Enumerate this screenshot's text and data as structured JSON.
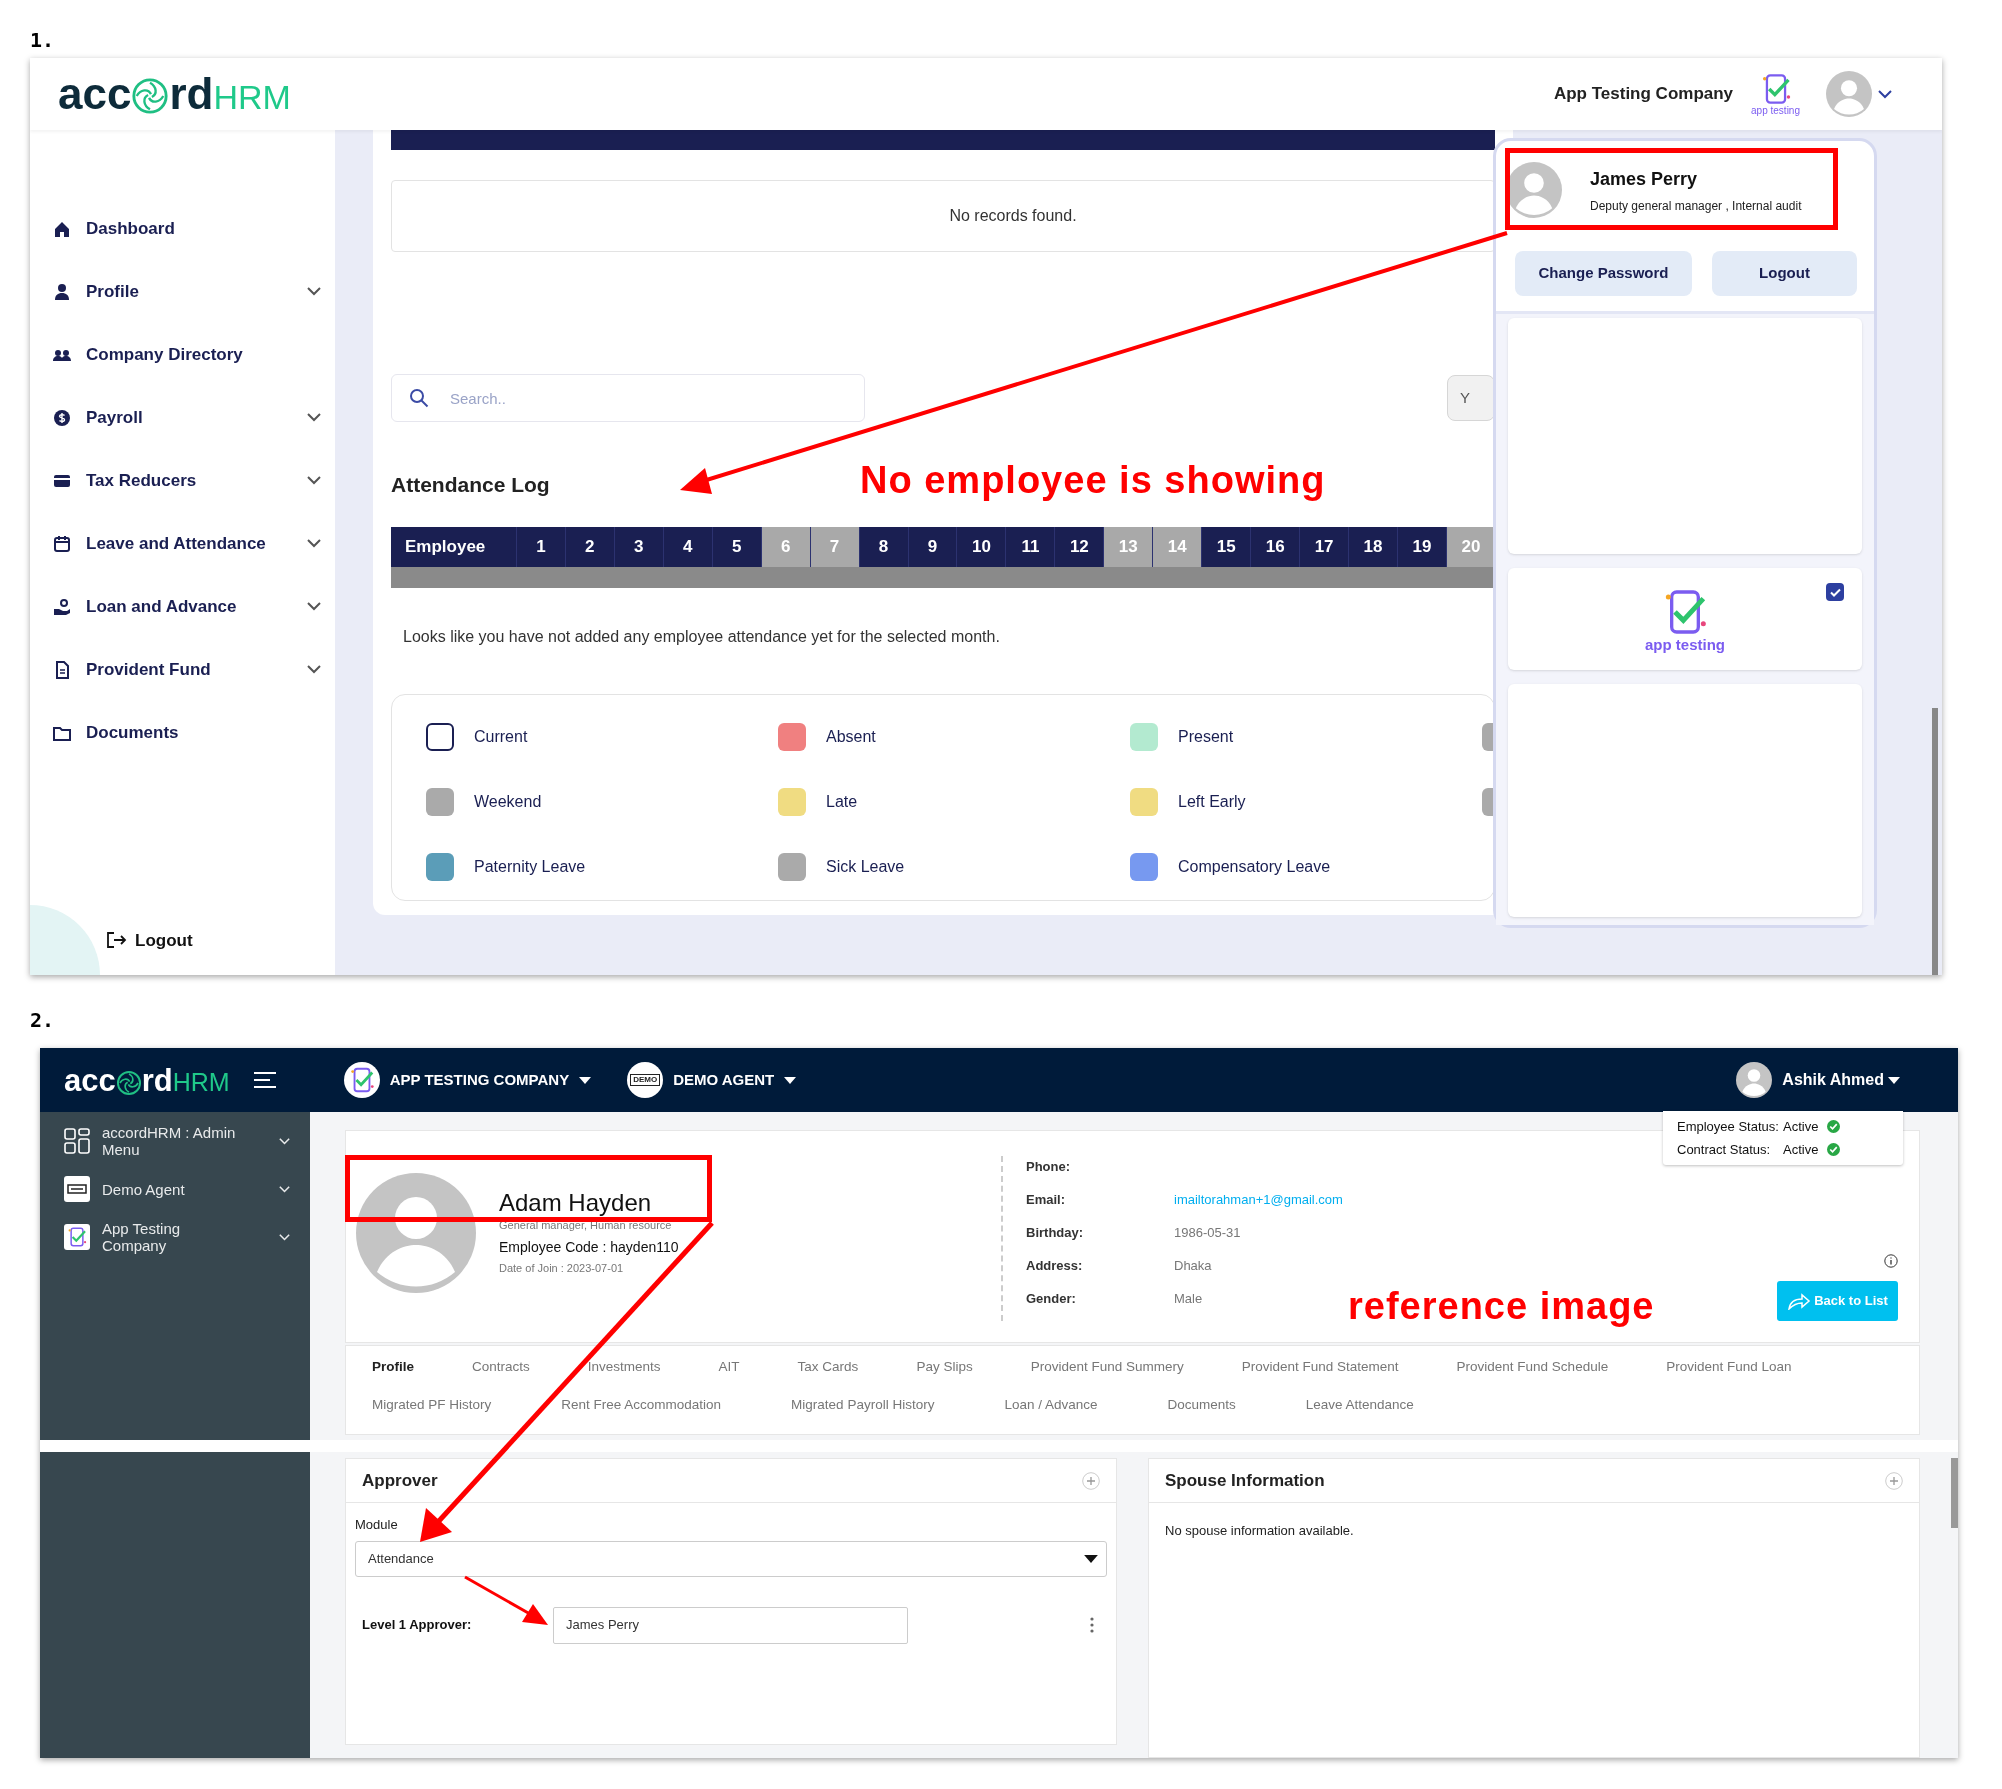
{
  "panel_1": {
    "label": "1.",
    "header": {
      "logo": {
        "left": "acc",
        "right": "rd",
        "suffix": "HRM"
      },
      "company": "App Testing Company",
      "company_logo_text": "app testing"
    },
    "sidebar": {
      "items": [
        {
          "label": "Dashboard",
          "has_submenu": false
        },
        {
          "label": "Profile",
          "has_submenu": true
        },
        {
          "label": "Company Directory",
          "has_submenu": false
        },
        {
          "label": "Payroll",
          "has_submenu": true
        },
        {
          "label": "Tax Reducers",
          "has_submenu": true
        },
        {
          "label": "Leave and Attendance",
          "has_submenu": true
        },
        {
          "label": "Loan and Advance",
          "has_submenu": true
        },
        {
          "label": "Provident Fund",
          "has_submenu": true
        },
        {
          "label": "Documents",
          "has_submenu": false
        }
      ],
      "logout": "Logout"
    },
    "records_message": "No records found.",
    "search": {
      "placeholder": "Search.."
    },
    "cut_button": "Y",
    "title": "Attendance Log",
    "day_header": {
      "first": "Employee",
      "days": [
        {
          "label": "1",
          "weekend": false
        },
        {
          "label": "2",
          "weekend": false
        },
        {
          "label": "3",
          "weekend": false
        },
        {
          "label": "4",
          "weekend": false
        },
        {
          "label": "5",
          "weekend": false
        },
        {
          "label": "6",
          "weekend": true
        },
        {
          "label": "7",
          "weekend": true
        },
        {
          "label": "8",
          "weekend": false
        },
        {
          "label": "9",
          "weekend": false
        },
        {
          "label": "10",
          "weekend": false
        },
        {
          "label": "11",
          "weekend": false
        },
        {
          "label": "12",
          "weekend": false
        },
        {
          "label": "13",
          "weekend": true
        },
        {
          "label": "14",
          "weekend": true
        },
        {
          "label": "15",
          "weekend": false
        },
        {
          "label": "16",
          "weekend": false
        },
        {
          "label": "17",
          "weekend": false
        },
        {
          "label": "18",
          "weekend": false
        },
        {
          "label": "19",
          "weekend": false
        },
        {
          "label": "20",
          "weekend": true
        }
      ]
    },
    "empty_message": "Looks like you have not added any employee attendance yet for the selected month.",
    "legend": [
      {
        "label": "Current",
        "kind": "outline",
        "color": "#1a1f52"
      },
      {
        "label": "Absent",
        "kind": "swatch",
        "color": "#f08080"
      },
      {
        "label": "Present",
        "kind": "swatch",
        "color": "#b3ead0"
      },
      {
        "kind": "swatch",
        "color": "#aaaaaa"
      },
      {
        "label": "Weekend",
        "kind": "swatch",
        "color": "#aaaaaa"
      },
      {
        "label": "Late",
        "kind": "swatch",
        "color": "#f0dc82"
      },
      {
        "label": "Left Early",
        "kind": "swatch",
        "color": "#f0dc82"
      },
      {
        "kind": "swatch",
        "color": "#aaaaaa"
      },
      {
        "label": "Paternity Leave",
        "kind": "swatch",
        "color": "#5b9db8"
      },
      {
        "label": "Sick Leave",
        "kind": "swatch",
        "color": "#aaaaaa"
      },
      {
        "label": "Compensatory Leave",
        "kind": "swatch",
        "color": "#7799f0"
      }
    ],
    "user_menu": {
      "name": "James Perry",
      "role": "Deputy general manager , Internal audit",
      "buttons": [
        "Change Password",
        "Logout"
      ],
      "company_card": {
        "logo_text": "app testing",
        "checked": true
      }
    }
  },
  "panel_2": {
    "label": "2.",
    "header": {
      "logo": {
        "left": "acc",
        "right": "rd",
        "suffix": "HRM"
      },
      "company": "APP TESTING COMPANY",
      "agent_badge": "DEMO",
      "agent": "DEMO AGENT",
      "user": "Ashik Ahmed"
    },
    "sidebar": [
      {
        "label": "accordHRM : Admin Menu"
      },
      {
        "label": "Demo Agent"
      },
      {
        "label": "App Testing Company"
      }
    ],
    "profile": {
      "name": "Adam Hayden",
      "role": "General manager, Human resource",
      "code": "Employee Code : hayden110",
      "join": "Date of Join : 2023-07-01"
    },
    "details": [
      {
        "label": "Phone:"
      },
      {
        "label": "Email:",
        "kind": "link",
        "value": "imailtorahman+1@gmail.com"
      },
      {
        "label": "Birthday:",
        "kind": "text",
        "value": "1986-05-31"
      },
      {
        "label": "Address:",
        "kind": "text",
        "value": "Dhaka"
      },
      {
        "label": "Gender:",
        "kind": "text",
        "value": "Male"
      }
    ],
    "status": [
      {
        "label": "Employee Status:",
        "value": "Active"
      },
      {
        "label": "Contract Status:",
        "value": "Active"
      }
    ],
    "back_button": "Back to List",
    "tab_rows": [
      [
        {
          "label": "Profile",
          "selected": true
        },
        {
          "label": "Contracts",
          "selected": false
        },
        {
          "label": "Investments",
          "selected": false
        },
        {
          "label": "AIT",
          "selected": false
        },
        {
          "label": "Tax Cards",
          "selected": false
        },
        {
          "label": "Pay Slips",
          "selected": false
        },
        {
          "label": "Provident Fund Summery",
          "selected": false
        },
        {
          "label": "Provident Fund Statement",
          "selected": false
        },
        {
          "label": "Provident Fund Schedule",
          "selected": false
        },
        {
          "label": "Provident Fund Loan",
          "selected": false
        }
      ],
      [
        {
          "label": "Migrated PF History",
          "selected": false
        },
        {
          "label": "Rent Free Accommodation",
          "selected": false
        },
        {
          "label": "Migrated Payroll History",
          "selected": false
        },
        {
          "label": "Loan / Advance",
          "selected": false
        },
        {
          "label": "Documents",
          "selected": false
        },
        {
          "label": "Leave Attendance",
          "selected": false
        }
      ]
    ],
    "approver": {
      "title": "Approver",
      "module_label": "Module",
      "module_value": "Attendance",
      "level_label": "Level 1 Approver:",
      "level_value": "James Perry"
    },
    "spouse": {
      "title": "Spouse Information",
      "message": "No spouse information available."
    }
  },
  "annotations": [
    {
      "text": "No employee is showing"
    },
    {
      "text": "reference image"
    }
  ]
}
